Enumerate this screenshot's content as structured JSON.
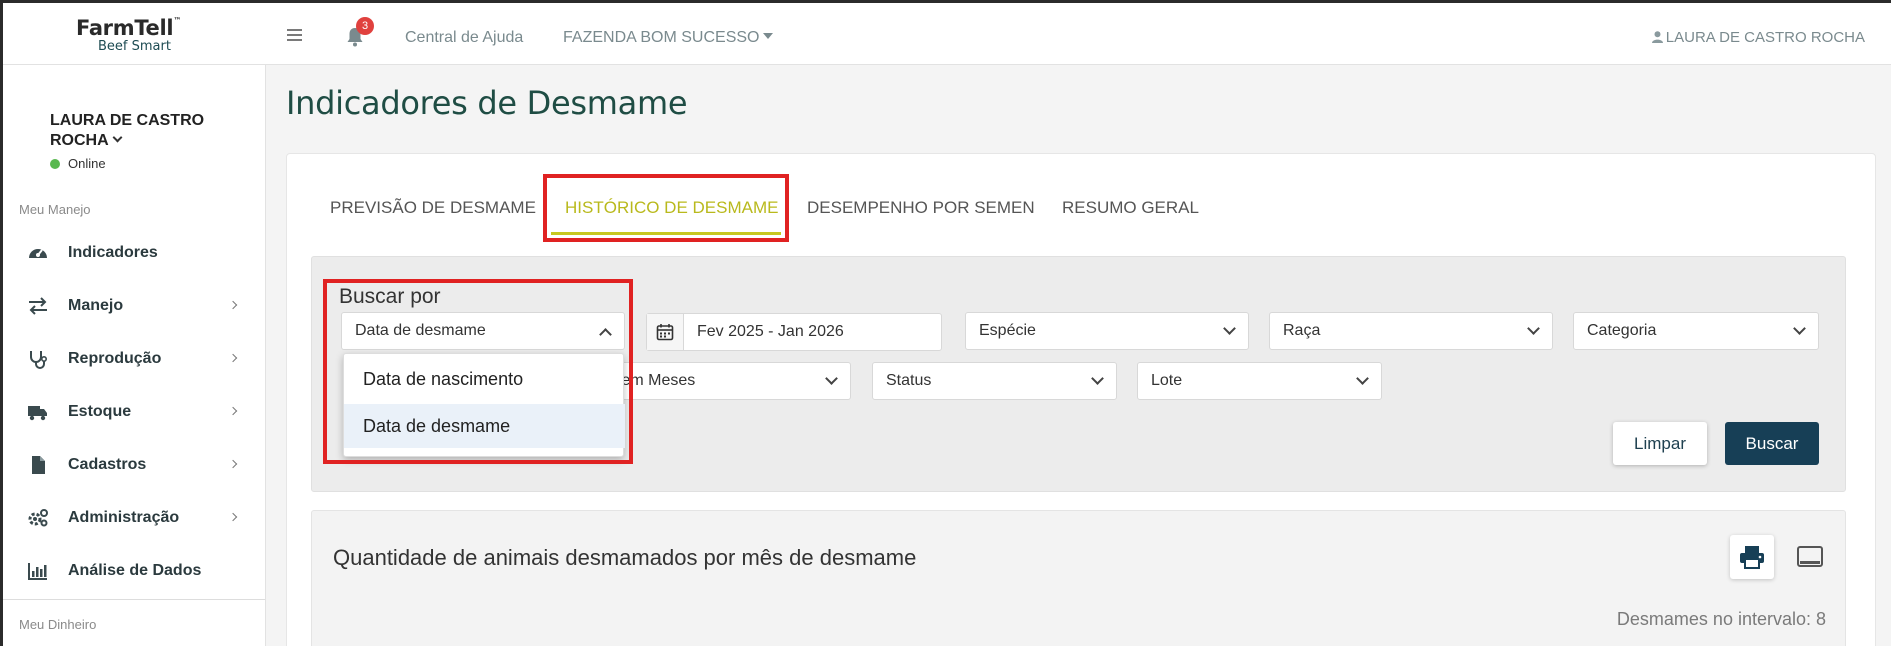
{
  "topbar": {
    "logo_main": "FarmTell",
    "logo_tm": "™",
    "logo_sub": "Beef Smart",
    "notification_count": "3",
    "help_link": "Central de Ajuda",
    "farm_selector": "FAZENDA BOM SUCESSO",
    "user_name": "LAURA DE CASTRO ROCHA"
  },
  "sidebar": {
    "user_name": "LAURA DE CASTRO ROCHA",
    "status": "Online",
    "section_manejo": "Meu Manejo",
    "section_dinheiro": "Meu Dinheiro",
    "items": [
      {
        "label": "Indicadores",
        "icon": "dashboard-icon"
      },
      {
        "label": "Manejo",
        "icon": "arrows-icon"
      },
      {
        "label": "Reprodução",
        "icon": "stethoscope-icon"
      },
      {
        "label": "Estoque",
        "icon": "truck-icon"
      },
      {
        "label": "Cadastros",
        "icon": "file-icon"
      },
      {
        "label": "Administração",
        "icon": "cogs-icon"
      },
      {
        "label": "Análise de Dados",
        "icon": "bar-chart-icon"
      }
    ]
  },
  "page": {
    "title": "Indicadores de Desmame",
    "tabs": [
      {
        "label": "PREVISÃO DE DESMAME"
      },
      {
        "label": "HISTÓRICO DE DESMAME",
        "active": true
      },
      {
        "label": "DESEMPENHO POR SEMEN"
      },
      {
        "label": "RESUMO GERAL"
      }
    ]
  },
  "filters": {
    "buscar_label": "Buscar por",
    "buscar_value": "Data de desmame",
    "date_range": "Fev 2025 - Jan 2026",
    "especie": "Espécie",
    "raca": "Raça",
    "categoria": "Categoria",
    "idade": "Idade em Meses",
    "status": "Status",
    "lote": "Lote",
    "dropdown_options": [
      "Data de nascimento",
      "Data de desmame"
    ],
    "selected_option": "Data de desmame",
    "limpar_label": "Limpar",
    "buscar_button": "Buscar"
  },
  "panel": {
    "title": "Quantidade de animais desmamados por mês de desmame",
    "summary": "Desmames no intervalo: 8"
  },
  "colors": {
    "accent_tab": "#c7c720",
    "highlight": "#e02222",
    "primary_button": "#173f56",
    "title": "#1f4d44"
  }
}
